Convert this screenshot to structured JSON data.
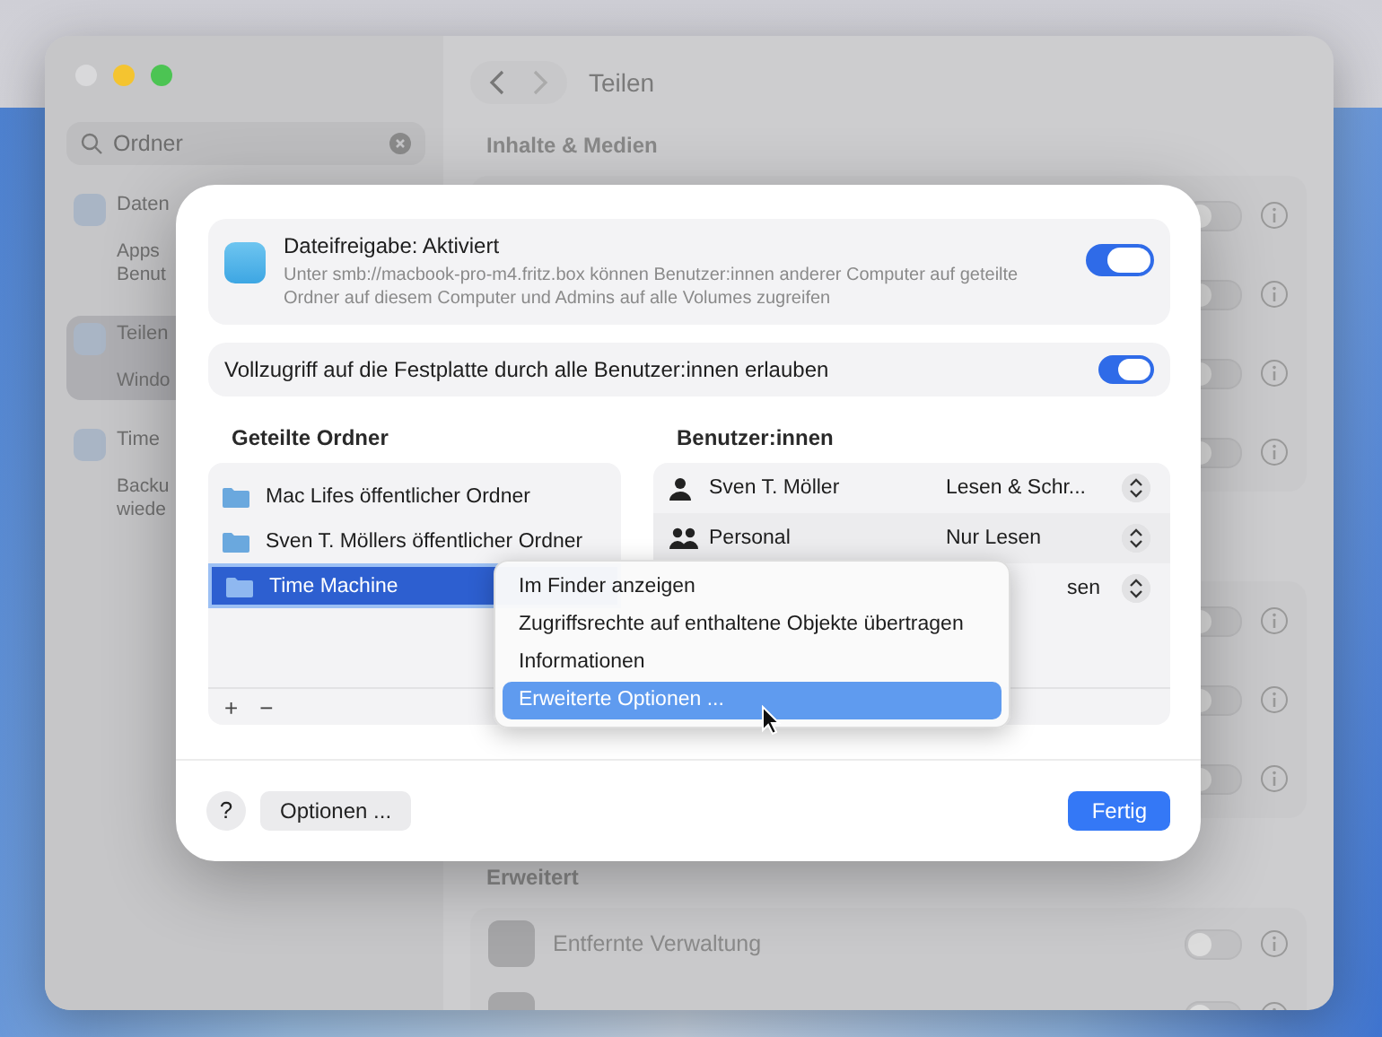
{
  "window": {
    "title": "Teilen"
  },
  "sidebar": {
    "search": {
      "value": "Ordner"
    },
    "items": [
      {
        "title": "Daten",
        "subtitle": "Apps\nBenut",
        "selected": false
      },
      {
        "title": "Teilen",
        "subtitle": "Windo",
        "selected": true
      },
      {
        "title": "Time",
        "subtitle": "Backu\nwiede",
        "selected": false
      }
    ]
  },
  "content": {
    "section": "Inhalte & Medien",
    "groups": [
      {
        "rows": [
          {
            "on": false
          },
          {
            "on": false
          },
          {
            "on": false
          },
          {
            "on": false
          }
        ]
      },
      {
        "rows": [
          {
            "on": false
          },
          {
            "on": false
          },
          {
            "on": false
          }
        ]
      }
    ],
    "advanced": {
      "heading": "Erweitert",
      "rows": [
        {
          "label": "Entfernte Verwaltung",
          "on": false
        },
        {
          "on": false
        }
      ]
    }
  },
  "dialog": {
    "sharing": {
      "title": "Dateifreigabe: Aktiviert",
      "description": "Unter smb://macbook-pro-m4.fritz.box können Benutzer:innen anderer Computer auf geteilte Ordner auf diesem Computer und Admins auf alle Volumes zugreifen",
      "on": true
    },
    "full_access": {
      "label": "Vollzugriff auf die Festplatte durch alle Benutzer:innen erlauben",
      "on": true
    },
    "folders": {
      "heading": "Geteilte Ordner",
      "items": [
        {
          "name": "Mac Lifes öffentlicher Ordner",
          "selected": false
        },
        {
          "name": "Sven T. Möllers öffentlicher Ordner",
          "selected": false
        },
        {
          "name": "Time Machine",
          "selected": true
        }
      ],
      "add": "+",
      "remove": "−"
    },
    "users": {
      "heading": "Benutzer:innen",
      "items": [
        {
          "kind": "person",
          "name": "Sven T. Möller",
          "permission": "Lesen & Schr..."
        },
        {
          "kind": "group",
          "name": "Personal",
          "permission": "Nur Lesen"
        },
        {
          "permission": "sen"
        }
      ]
    },
    "context_menu": [
      {
        "label": "Im Finder anzeigen",
        "selected": false
      },
      {
        "label": "Zugriffsrechte auf enthaltene Objekte übertragen",
        "selected": false
      },
      {
        "label": "Informationen",
        "selected": false
      },
      {
        "label": "Erweiterte Optionen ...",
        "selected": true
      }
    ],
    "help": "?",
    "options": "Optionen ...",
    "done": "Fertig"
  }
}
